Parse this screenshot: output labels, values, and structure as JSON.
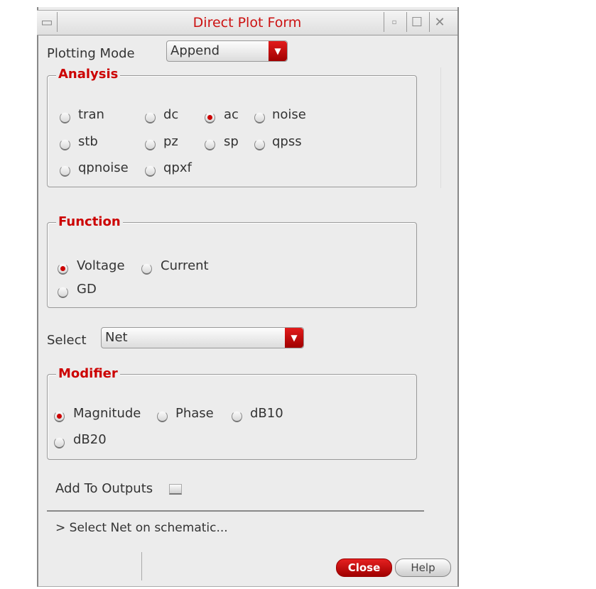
{
  "window": {
    "title": "Direct Plot Form"
  },
  "plotting_mode": {
    "label": "Plotting Mode",
    "value": "Append"
  },
  "analysis": {
    "legend": "Analysis",
    "options": [
      {
        "label": "tran",
        "selected": false
      },
      {
        "label": "dc",
        "selected": false
      },
      {
        "label": "ac",
        "selected": true
      },
      {
        "label": "noise",
        "selected": false
      },
      {
        "label": "stb",
        "selected": false
      },
      {
        "label": "pz",
        "selected": false
      },
      {
        "label": "sp",
        "selected": false
      },
      {
        "label": "qpss",
        "selected": false
      },
      {
        "label": "qpnoise",
        "selected": false
      },
      {
        "label": "qpxf",
        "selected": false
      }
    ]
  },
  "function": {
    "legend": "Function",
    "options": [
      {
        "label": "Voltage",
        "selected": true
      },
      {
        "label": "Current",
        "selected": false
      },
      {
        "label": "GD",
        "selected": false
      }
    ]
  },
  "select": {
    "label": "Select",
    "value": "Net"
  },
  "modifier": {
    "legend": "Modifier",
    "options": [
      {
        "label": "Magnitude",
        "selected": true
      },
      {
        "label": "Phase",
        "selected": false
      },
      {
        "label": "dB10",
        "selected": false
      },
      {
        "label": "dB20",
        "selected": false
      }
    ]
  },
  "add_to_outputs": {
    "label": "Add To Outputs",
    "checked": false
  },
  "status": "> Select Net on schematic...",
  "buttons": {
    "close": "Close",
    "help": "Help"
  }
}
